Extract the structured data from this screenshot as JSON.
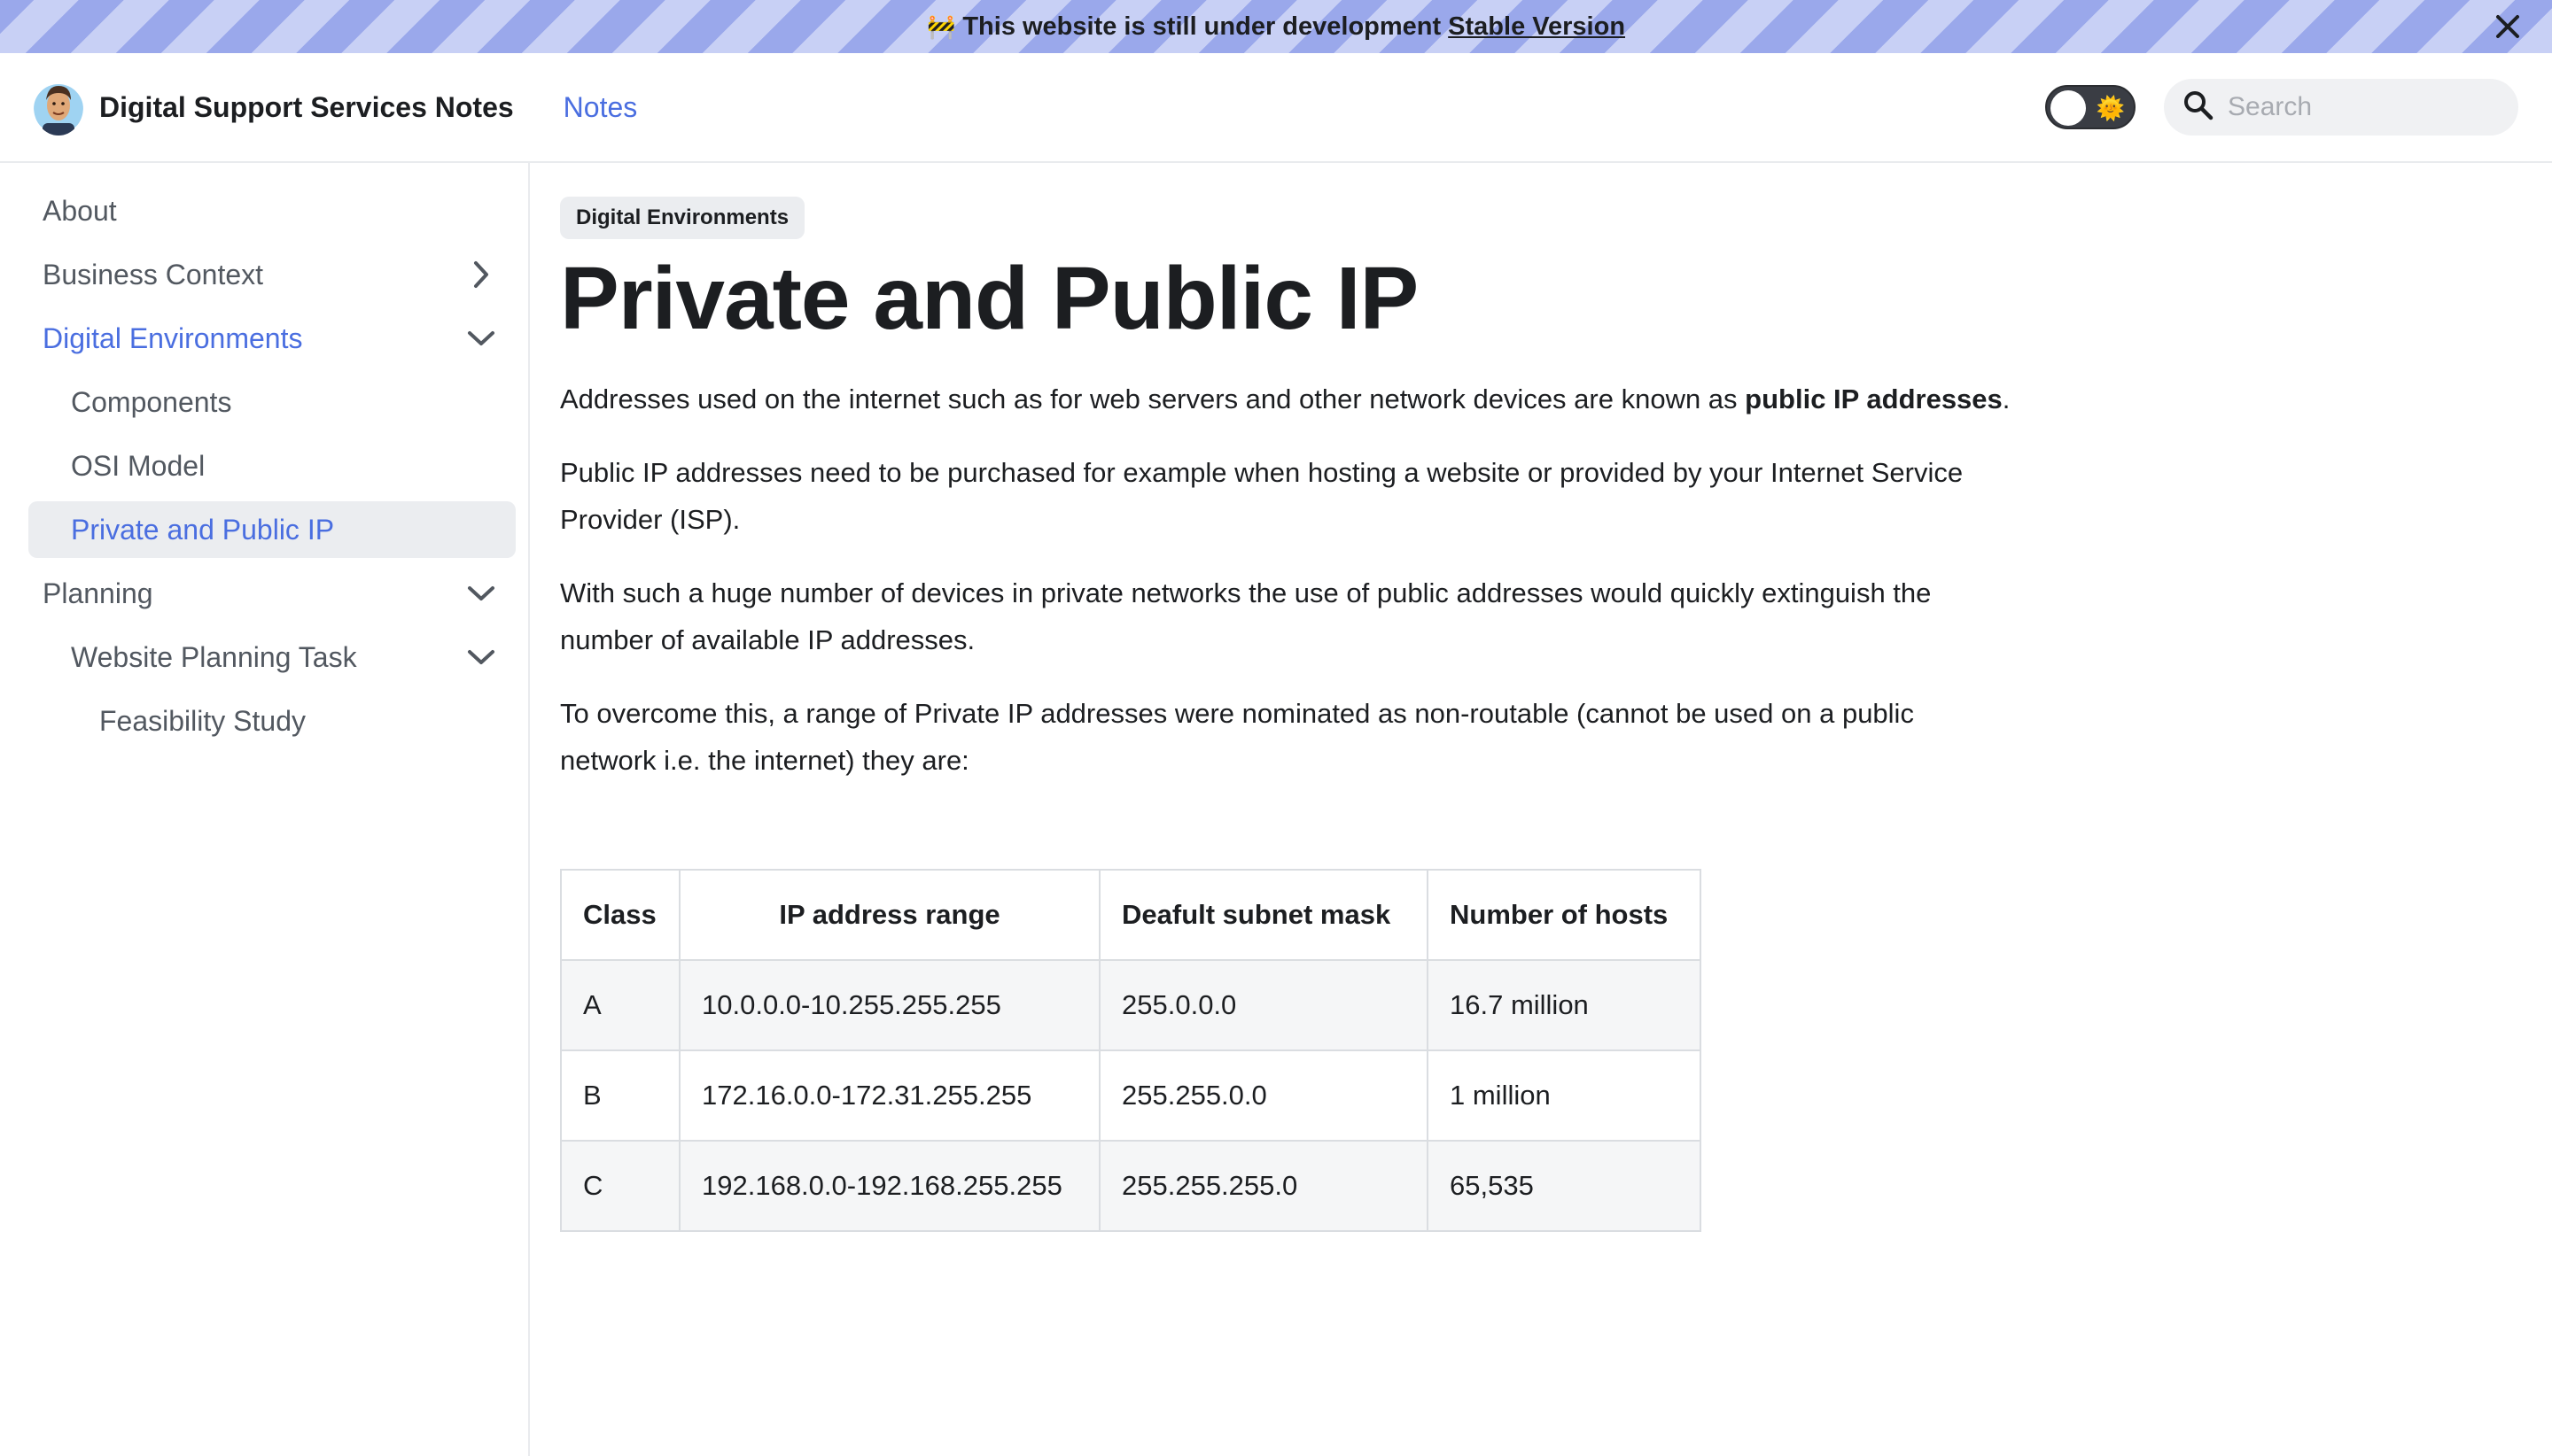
{
  "announcement": {
    "text": "This website is still under development",
    "link": "Stable Version"
  },
  "navbar": {
    "brand_title": "Digital Support Services Notes",
    "nav_link": "Notes",
    "search_placeholder": "Search"
  },
  "sidebar": {
    "items": [
      {
        "label": "About"
      },
      {
        "label": "Business Context"
      },
      {
        "label": "Digital Environments"
      },
      {
        "label": "Components"
      },
      {
        "label": "OSI Model"
      },
      {
        "label": "Private and Public IP"
      },
      {
        "label": "Planning"
      },
      {
        "label": "Website Planning Task"
      },
      {
        "label": "Feasibility Study"
      }
    ]
  },
  "article": {
    "tag": "Digital Environments",
    "title": "Private and Public IP",
    "p1_start": "Addresses used on the internet such as for web servers and other network devices are known as ",
    "p1_bold": "public IP addresses",
    "p1_end": ".",
    "p2": "Public IP addresses need to be purchased for example when hosting a website or provided by your Internet Service Provider (ISP).",
    "p3": "With such a huge number of devices in private networks the use of public addresses would quickly extinguish the number of available IP addresses.",
    "p4": "To overcome this, a range of Private IP addresses were nominated as non-routable (cannot be used on a public network i.e. the internet) they are:"
  },
  "table": {
    "headers": [
      "Class",
      "IP address range",
      "Deafult subnet mask",
      "Number of hosts"
    ],
    "rows": [
      [
        "A",
        "10.0.0.0-10.255.255.255",
        "255.0.0.0",
        "16.7 million"
      ],
      [
        "B",
        "172.16.0.0-172.31.255.255",
        "255.255.0.0",
        "1 million"
      ],
      [
        "C",
        "192.168.0.0-192.168.255.255",
        "255.255.255.0",
        "65,535"
      ]
    ]
  }
}
